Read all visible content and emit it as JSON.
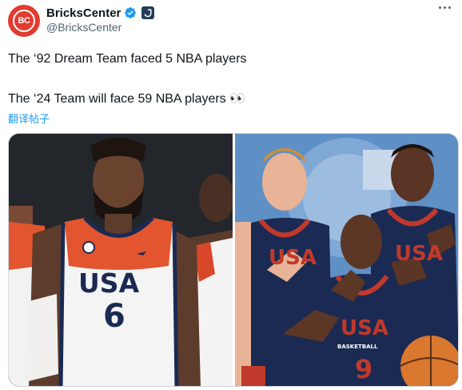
{
  "author": {
    "display_name": "BricksCenter",
    "handle": "@BricksCenter",
    "avatar_text": "BC"
  },
  "tweet": {
    "line1": "The ‘92 Dream Team faced 5 NBA players",
    "line2": "The ‘24 Team will face 59 NBA players 👀",
    "translate_label": "翻译帖子"
  },
  "media": {
    "left_photo": {
      "jersey_text": "USA",
      "jersey_number": "6"
    },
    "right_photo": {
      "jersey_text": "USA",
      "jersey_number": "9",
      "jersey_small": "BASKETBALL"
    }
  },
  "colors": {
    "accent": "#1d9bf0",
    "avatar_bg": "#e23b2f"
  },
  "icons": {
    "verified": "verified-badge-icon",
    "affiliate": "affiliate-badge-icon",
    "more": "more-options-icon"
  }
}
